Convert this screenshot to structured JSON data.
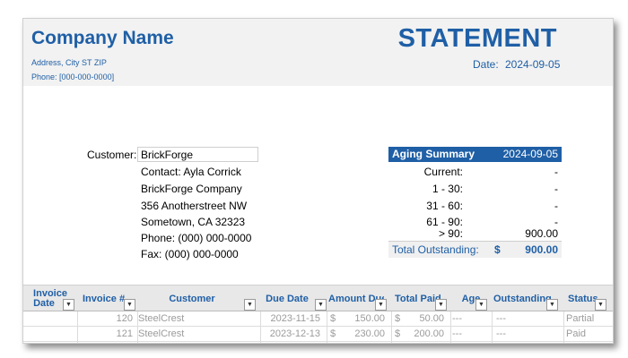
{
  "header": {
    "company_name": "Company Name",
    "address": "Address, City ST ZIP",
    "phone": "Phone: [000-000-0000]",
    "title": "STATEMENT",
    "date_label": "Date:",
    "date_value": "2024-09-05"
  },
  "customer": {
    "label": "Customer:",
    "name": "BrickForge",
    "contact": "Contact: Ayla Corrick",
    "company": "BrickForge Company",
    "street": "356 Anotherstreet NW",
    "city": "Sometown, CA 32323",
    "phone": "Phone: (000) 000-0000",
    "fax": "Fax: (000) 000-0000"
  },
  "aging": {
    "title": "Aging Summary",
    "date": "2024-09-05",
    "rows": [
      {
        "label": "Current:",
        "value": "-"
      },
      {
        "label": "1 - 30:",
        "value": "-"
      },
      {
        "label": "31 - 60:",
        "value": "-"
      },
      {
        "label": "61 - 90:",
        "value": "-"
      },
      {
        "label": "> 90:",
        "value": "900.00"
      }
    ],
    "total_label": "Total Outstanding:",
    "total_currency": "$",
    "total_value": "900.00"
  },
  "table": {
    "headers": {
      "invoice_date_1": "Invoice",
      "invoice_date_2": "Date",
      "invoice_num": "Invoice #",
      "customer": "Customer",
      "due_date": "Due Date",
      "amount_due": "Amount Due",
      "total_paid": "Total Paid",
      "age": "Age",
      "outstanding": "Outstanding",
      "status": "Status"
    },
    "rows": [
      {
        "invoice_date": "",
        "invoice_num": "120",
        "customer": "SteelCrest",
        "due_date": "2023-11-15",
        "amount_cur": "$",
        "amount": "150.00",
        "paid_cur": "$",
        "paid": "50.00",
        "age": "---",
        "outstanding": "---",
        "status": "Partial"
      },
      {
        "invoice_date": "",
        "invoice_num": "121",
        "customer": "SteelCrest",
        "due_date": "2023-12-13",
        "amount_cur": "$",
        "amount": "230.00",
        "paid_cur": "$",
        "paid": "200.00",
        "age": "---",
        "outstanding": "---",
        "status": "Paid"
      }
    ]
  },
  "colors": {
    "accent": "#1f5fa6",
    "header_band": "#f2f2f2"
  }
}
